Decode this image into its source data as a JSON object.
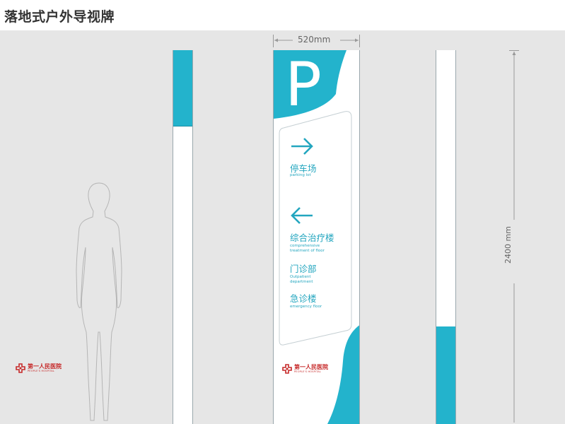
{
  "header": {
    "title": "落地式户外导视牌"
  },
  "dimensions": {
    "width_label": "520mm",
    "height_label": "2400 mm"
  },
  "sign": {
    "parking_letter": "P",
    "entries": [
      {
        "arrow": "right",
        "zh": "停车场",
        "en": [
          "parking lot"
        ]
      },
      {
        "arrow": "left",
        "zh": "综合治疗楼",
        "en": [
          "comprehensive",
          "treatment of floor"
        ]
      },
      {
        "arrow": "none",
        "zh": "门诊部",
        "en": [
          "Outpatient",
          "department"
        ]
      },
      {
        "arrow": "none",
        "zh": "急诊楼",
        "en": [
          "emergency floor"
        ]
      }
    ]
  },
  "logo": {
    "name_cn": "第一人民医院",
    "name_en": "PEOPLE'S HOSPITAL"
  },
  "colors": {
    "accent": "#23b3cc",
    "logo_red": "#c62828",
    "background": "#e6e6e6"
  }
}
